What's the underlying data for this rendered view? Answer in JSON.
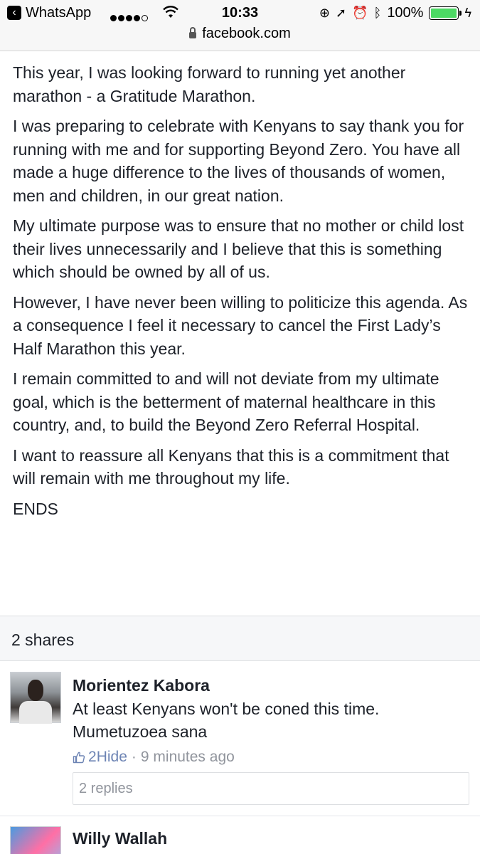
{
  "status_bar": {
    "back_app": "WhatsApp",
    "time": "10:33",
    "battery": "100%",
    "url": "facebook.com"
  },
  "post": {
    "paragraphs": [
      "This year, I was looking forward to running yet another marathon - a Gratitude Marathon.",
      "I was preparing to celebrate with Kenyans to say thank you for running with me and for supporting Beyond Zero. You have all made a huge difference to the lives of thousands of women, men and children, in our great nation.",
      "My ultimate purpose was to ensure that no mother or child lost their lives unnecessarily and I believe that this is something which should be owned by all of us.",
      "However, I have never been willing to politicize this agenda. As a consequence I feel it necessary to cancel the First Lady’s Half Marathon this year.",
      "I remain committed to and will not deviate from my ultimate goal, which is the betterment of maternal healthcare in this country, and, to build the Beyond Zero Referral Hospital.",
      "I want to reassure all Kenyans that this is a commitment that will remain with me throughout my life.",
      "ENDS"
    ]
  },
  "shares": "2 shares",
  "comments": [
    {
      "name": "Morientez Kabora",
      "text_line1": "At least Kenyans won't be coned this time.",
      "text_line2": "Mumetuzoea sana",
      "likes": "2",
      "hide_label": "Hide",
      "separator": "·",
      "time": "9 minutes ago",
      "replies": "2 replies"
    },
    {
      "name": "Willy Wallah"
    }
  ]
}
